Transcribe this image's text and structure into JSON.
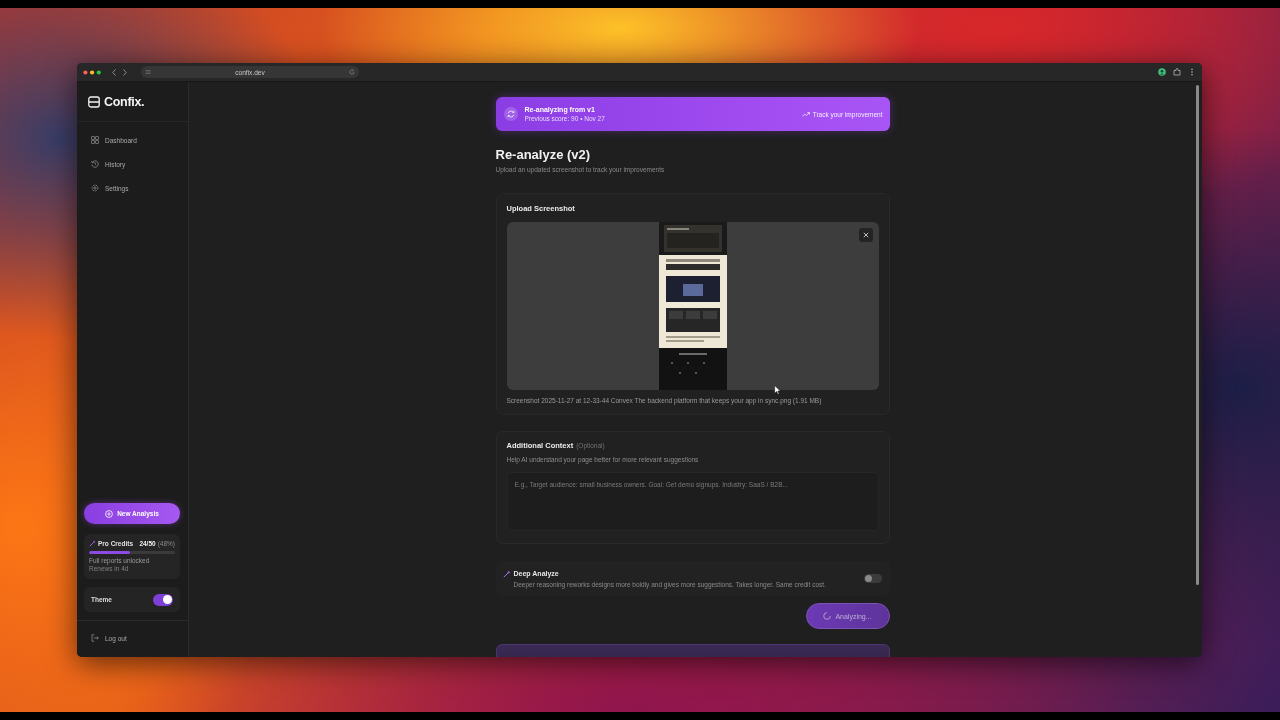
{
  "browser": {
    "url": "confix.dev"
  },
  "sidebar": {
    "logo": "Confix.",
    "nav": [
      {
        "label": "Dashboard",
        "selected": false
      },
      {
        "label": "History",
        "selected": false
      },
      {
        "label": "Settings",
        "selected": false
      }
    ],
    "new_analysis": "New Analysis",
    "credits": {
      "label": "Pro Credits",
      "count": "24/50",
      "percent": "(48%)",
      "level": 0.48,
      "note": "Full reports unlocked",
      "subnote": "Renews in 4d"
    },
    "theme": {
      "label": "Theme",
      "on": true
    },
    "logout": "Log out"
  },
  "banner": {
    "title": "Re-analyzing from v1",
    "subtitle": "Previous score: 90 • Nov 27",
    "link": "Track your improvement"
  },
  "page": {
    "title": "Re-analyze (v2)",
    "subtitle": "Upload an updated screenshot to track your improvements"
  },
  "upload": {
    "title": "Upload Screenshot",
    "file_caption": "Screenshot 2025-11-27 at 12-33-44 Convex The backend platform that keeps your app in sync.png (1.91 MB)"
  },
  "context": {
    "title": "Additional Context",
    "optional": "(Optional)",
    "hint": "Help AI understand your page better for more relevant suggestions",
    "placeholder": "E.g., Target audience: small business owners. Goal: Get demo signups. Industry: SaaS / B2B..."
  },
  "deep_analyze": {
    "title": "Deep Analyze",
    "description": "Deeper reasoning reworks designs more boldly and gives more suggestions. Takes longer. Same credit cost.",
    "on": false
  },
  "submit": {
    "label": "Analyzing...",
    "busy": true
  }
}
